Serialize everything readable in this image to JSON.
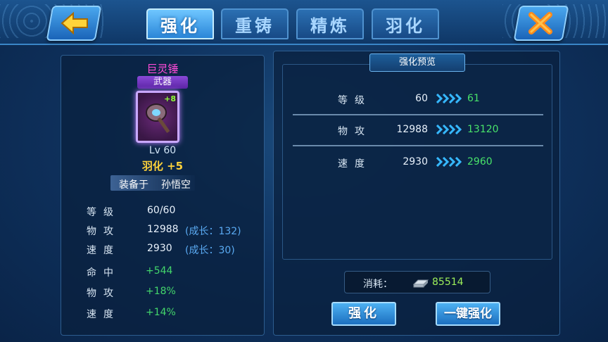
{
  "tabs": [
    {
      "label": "强化",
      "active": true
    },
    {
      "label": "重铸",
      "active": false
    },
    {
      "label": "精炼",
      "active": false
    },
    {
      "label": "羽化",
      "active": false
    }
  ],
  "item": {
    "name": "巨灵锤",
    "type": "武器",
    "plus": "+8",
    "level": "Lv 60",
    "yuhua": "羽化 +5",
    "equipped_label": "装备于",
    "equipped_to": "孙悟空"
  },
  "base_stats": [
    {
      "label": "等级",
      "value": "60/60",
      "growth": ""
    },
    {
      "label": "物攻",
      "value": "12988",
      "growth": "(成长：132)"
    },
    {
      "label": "速度",
      "value": "2930",
      "growth": "(成长：30)"
    }
  ],
  "bonus_stats": [
    {
      "label": "命中",
      "value": "+544"
    },
    {
      "label": "物攻",
      "value": "+18%"
    },
    {
      "label": "速度",
      "value": "+14%"
    }
  ],
  "preview": {
    "title": "强化预览",
    "rows": [
      {
        "label": "等级",
        "old": "60",
        "new": "61"
      },
      {
        "label": "物攻",
        "old": "12988",
        "new": "13120"
      },
      {
        "label": "速度",
        "old": "2930",
        "new": "2960"
      }
    ]
  },
  "cost": {
    "label": "消耗：",
    "value": "85514",
    "icon": "silver-ingot-icon"
  },
  "buttons": {
    "strengthen": "强化",
    "one_key": "一键强化"
  },
  "colors": {
    "accent": "#2a86d8",
    "increase": "#48e36a",
    "item_name": "#ff4bd8",
    "yuhua": "#ffd23a"
  }
}
